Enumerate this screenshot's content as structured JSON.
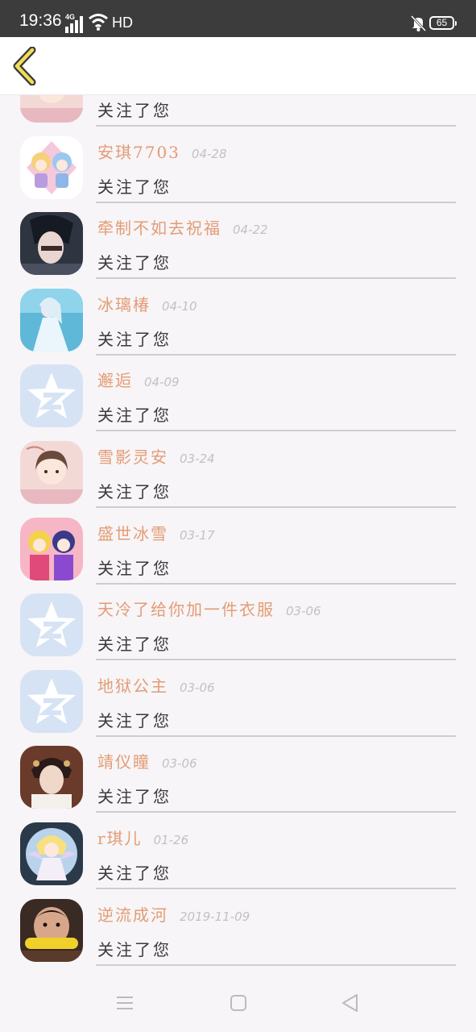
{
  "status_bar": {
    "time": "19:36",
    "network": "4G",
    "hd": "HD",
    "battery": "65",
    "icons": [
      "signal-icon",
      "wifi-icon",
      "mute-icon",
      "battery-icon"
    ]
  },
  "nav": {
    "back_icon": "chevron-left-icon",
    "accent_color": "#f2dc5a"
  },
  "colors": {
    "nickname": "#e39c76",
    "date": "#c4c0c4",
    "action": "#3a3a3a",
    "background": "#f7f5f7"
  },
  "notifications": [
    {
      "nickname": "",
      "date": "",
      "action": "关注了您",
      "avatar": "anime-girl-pink"
    },
    {
      "nickname": "安琪7703",
      "date": "04-28",
      "action": "关注了您",
      "avatar": "chibi-pair"
    },
    {
      "nickname": "牵制不如去祝福",
      "date": "04-22",
      "action": "关注了您",
      "avatar": "dark-portrait"
    },
    {
      "nickname": "冰璃椿",
      "date": "04-10",
      "action": "关注了您",
      "avatar": "ice-princess"
    },
    {
      "nickname": "邂逅",
      "date": "04-09",
      "action": "关注了您",
      "avatar": "default-qq-avatar"
    },
    {
      "nickname": "雪影灵安",
      "date": "03-24",
      "action": "关注了您",
      "avatar": "anime-girl-pink"
    },
    {
      "nickname": "盛世冰雪",
      "date": "03-17",
      "action": "关注了您",
      "avatar": "anime-duo"
    },
    {
      "nickname": "天冷了给你加一件衣服",
      "date": "03-06",
      "action": "关注了您",
      "avatar": "default-qq-avatar"
    },
    {
      "nickname": "地狱公主",
      "date": "03-06",
      "action": "关注了您",
      "avatar": "default-qq-avatar"
    },
    {
      "nickname": "靖仪瞳",
      "date": "03-06",
      "action": "关注了您",
      "avatar": "costume-portrait"
    },
    {
      "nickname": "r琪儿",
      "date": "01-26",
      "action": "关注了您",
      "avatar": "fairy-girl"
    },
    {
      "nickname": "逆流成河",
      "date": "2019-11-09",
      "action": "关注了您",
      "avatar": "boy-with-corn"
    }
  ],
  "system_nav": {
    "buttons": [
      "menu-icon",
      "home-icon",
      "back-triangle-icon"
    ]
  }
}
